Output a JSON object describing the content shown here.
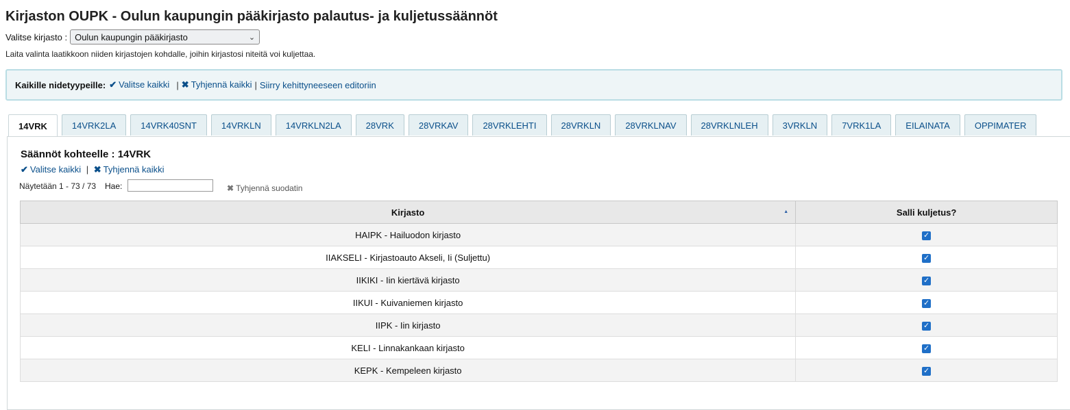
{
  "page": {
    "title": "Kirjaston OUPK - Oulun kaupungin pääkirjasto palautus- ja kuljetussäännöt",
    "select_label": "Valitse kirjasto :",
    "selected_library": "Oulun kaupungin pääkirjasto",
    "instructions": "Laita valinta laatikkoon niiden kirjastojen kohdalle, joihin kirjastosi niteitä voi kuljettaa."
  },
  "all_types": {
    "label": "Kaikille nidetyypeille:",
    "select_all": "Valitse kaikki",
    "clear_all": "Tyhjennä kaikki",
    "advanced_editor": "Siirry kehittyneeseen editoriin"
  },
  "tabs": [
    "14VRK",
    "14VRK2LA",
    "14VRK40SNT",
    "14VRKLN",
    "14VRKLN2LA",
    "28VRK",
    "28VRKAV",
    "28VRKLEHTI",
    "28VRKLN",
    "28VRKLNAV",
    "28VRKLNLEH",
    "3VRKLN",
    "7VRK1LA",
    "EILAINATA",
    "OPPIMATER"
  ],
  "panel": {
    "title": "Säännöt kohteelle : 14VRK",
    "select_all": "Valitse kaikki",
    "clear_all": "Tyhjennä kaikki",
    "showing": "Näytetään 1 - 73 / 73",
    "search_label": "Hae:",
    "search_value": "",
    "clear_filter": "Tyhjennä suodatin"
  },
  "table": {
    "columns": [
      "Kirjasto",
      "Salli kuljetus?"
    ],
    "rows": [
      {
        "library": "HAIPK - Hailuodon kirjasto",
        "allowed": true
      },
      {
        "library": "IIAKSELI - Kirjastoauto Akseli, Ii (Suljettu)",
        "allowed": true
      },
      {
        "library": "IIKIKI - Iin kiertävä kirjasto",
        "allowed": true
      },
      {
        "library": "IIKUI - Kuivaniemen kirjasto",
        "allowed": true
      },
      {
        "library": "IIPK - Iin kirjasto",
        "allowed": true
      },
      {
        "library": "KELI - Linnakankaan kirjasto",
        "allowed": true
      },
      {
        "library": "KEPK - Kempeleen kirjasto",
        "allowed": true
      }
    ]
  },
  "colors": {
    "link": "#0a4f8a",
    "checkbox": "#1f6fc7",
    "banner_bg": "#eef5f7",
    "banner_border": "#b9dde4"
  }
}
